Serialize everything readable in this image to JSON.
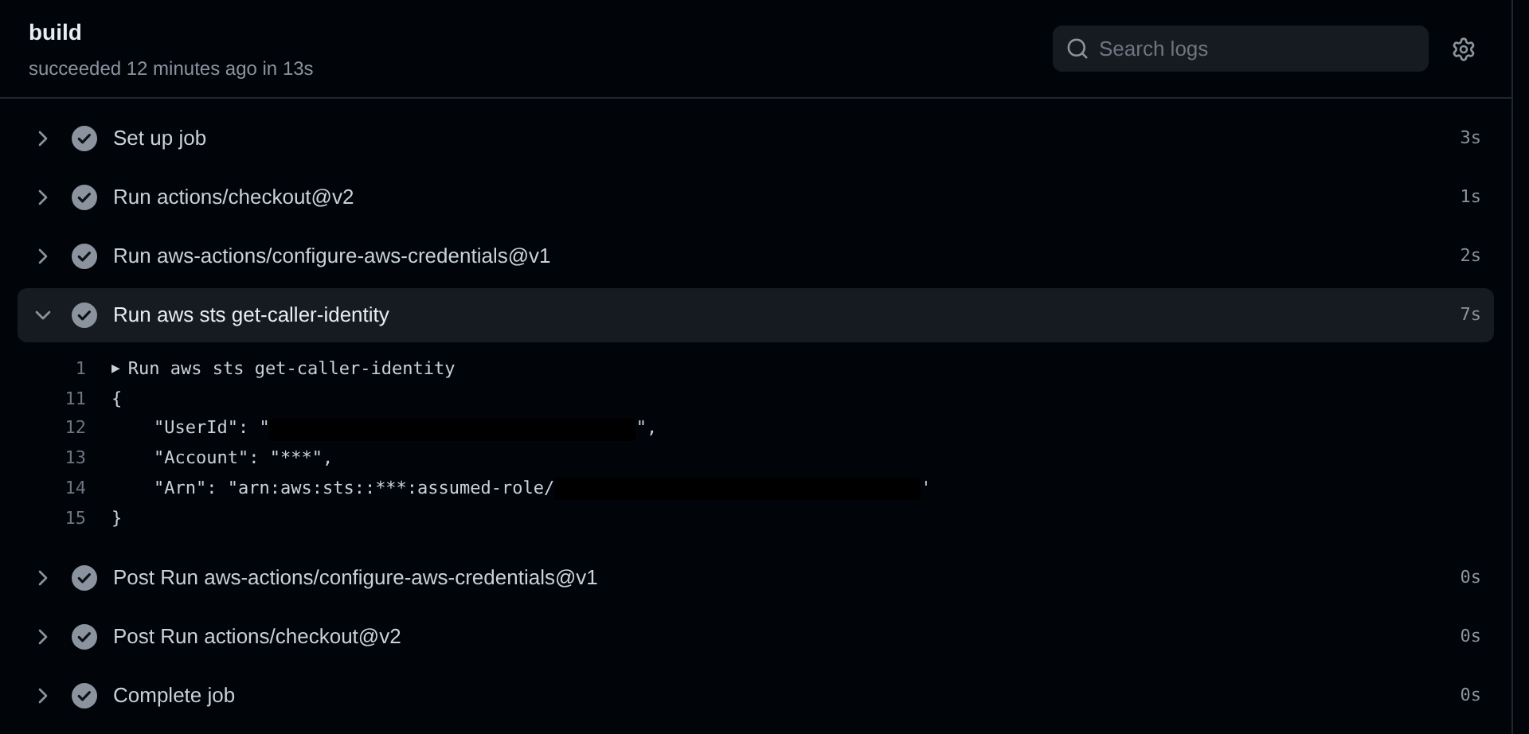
{
  "job": {
    "title": "build",
    "status": "succeeded 12 minutes ago in 13s"
  },
  "search": {
    "placeholder": "Search logs"
  },
  "steps": [
    {
      "name": "Set up job",
      "duration": "3s",
      "expanded": false
    },
    {
      "name": "Run actions/checkout@v2",
      "duration": "1s",
      "expanded": false
    },
    {
      "name": "Run aws-actions/configure-aws-credentials@v1",
      "duration": "2s",
      "expanded": false
    },
    {
      "name": "Run aws sts get-caller-identity",
      "duration": "7s",
      "expanded": true,
      "log": [
        {
          "number": "1",
          "toggle": "▶",
          "parts": [
            {
              "kind": "text",
              "text": "Run aws sts get-caller-identity"
            }
          ]
        },
        {
          "number": "11",
          "parts": [
            {
              "kind": "text",
              "text": "{"
            }
          ]
        },
        {
          "number": "12",
          "parts": [
            {
              "kind": "text",
              "text": "    \"UserId\": \""
            },
            {
              "kind": "redacted"
            },
            {
              "kind": "text",
              "text": "\","
            }
          ]
        },
        {
          "number": "13",
          "parts": [
            {
              "kind": "text",
              "text": "    \"Account\": \"***\","
            }
          ]
        },
        {
          "number": "14",
          "parts": [
            {
              "kind": "text",
              "text": "    \"Arn\": \"arn:aws:sts::***:assumed-role/"
            },
            {
              "kind": "redacted"
            },
            {
              "kind": "text",
              "text": "'"
            }
          ]
        },
        {
          "number": "15",
          "parts": [
            {
              "kind": "text",
              "text": "}"
            }
          ]
        }
      ]
    },
    {
      "name": "Post Run aws-actions/configure-aws-credentials@v1",
      "duration": "0s",
      "expanded": false
    },
    {
      "name": "Post Run actions/checkout@v2",
      "duration": "0s",
      "expanded": false
    },
    {
      "name": "Complete job",
      "duration": "0s",
      "expanded": false
    }
  ]
}
